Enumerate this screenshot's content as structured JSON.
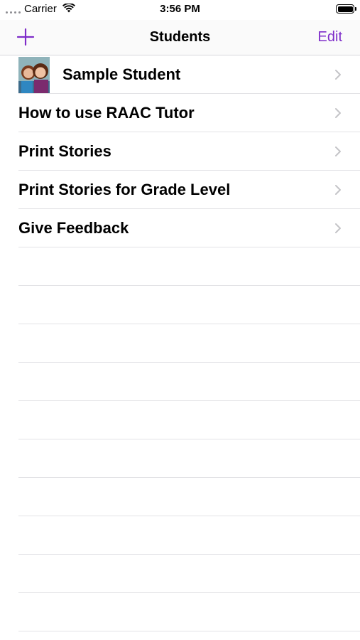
{
  "status_bar": {
    "carrier": "Carrier",
    "time": "3:56 PM",
    "icons": [
      "signal-dots-icon",
      "wifi-icon",
      "battery-icon"
    ]
  },
  "nav_bar": {
    "title": "Students",
    "edit_label": "Edit",
    "add_icon": "plus-icon"
  },
  "colors": {
    "accent": "#7e2cc9",
    "separator": "#e3e3e6",
    "chevron": "#c4c4c7"
  },
  "rows": [
    {
      "label": "Sample Student",
      "has_avatar": true
    },
    {
      "label": "How to use RAAC Tutor"
    },
    {
      "label": "Print Stories"
    },
    {
      "label": "Print Stories for Grade Level"
    },
    {
      "label": "Give Feedback"
    }
  ]
}
